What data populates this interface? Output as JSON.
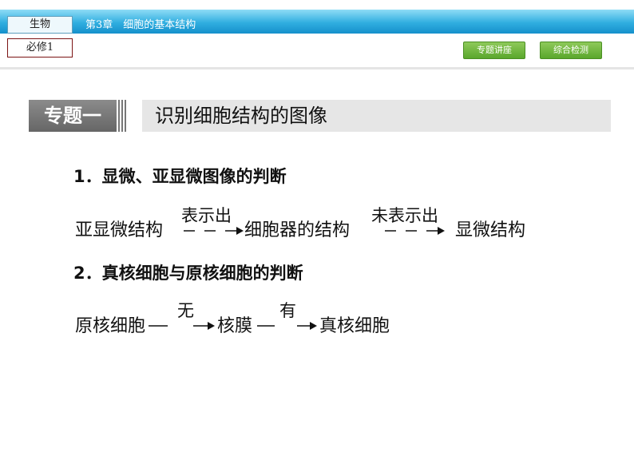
{
  "header": {
    "subject": "生物",
    "book": "必修1",
    "chapter": "第3章　细胞的基本结构",
    "nav_buttons": [
      "专题讲座",
      "综合检测"
    ]
  },
  "topic": {
    "label": "专题一",
    "title": "识别细胞结构的图像"
  },
  "section1": {
    "heading": "1．显微、亚显微图像的判断",
    "flow": {
      "start": "亚显微结构",
      "arrow1": "表示出",
      "middle": "细胞器的结构",
      "arrow2": "未表示出",
      "end": "显微结构"
    }
  },
  "section2": {
    "heading": "2．真核细胞与原核细胞的判断",
    "flow": {
      "start": "原核细胞",
      "arrow1": "无",
      "middle": "核膜",
      "arrow2": "有",
      "end": "真核细胞"
    }
  }
}
